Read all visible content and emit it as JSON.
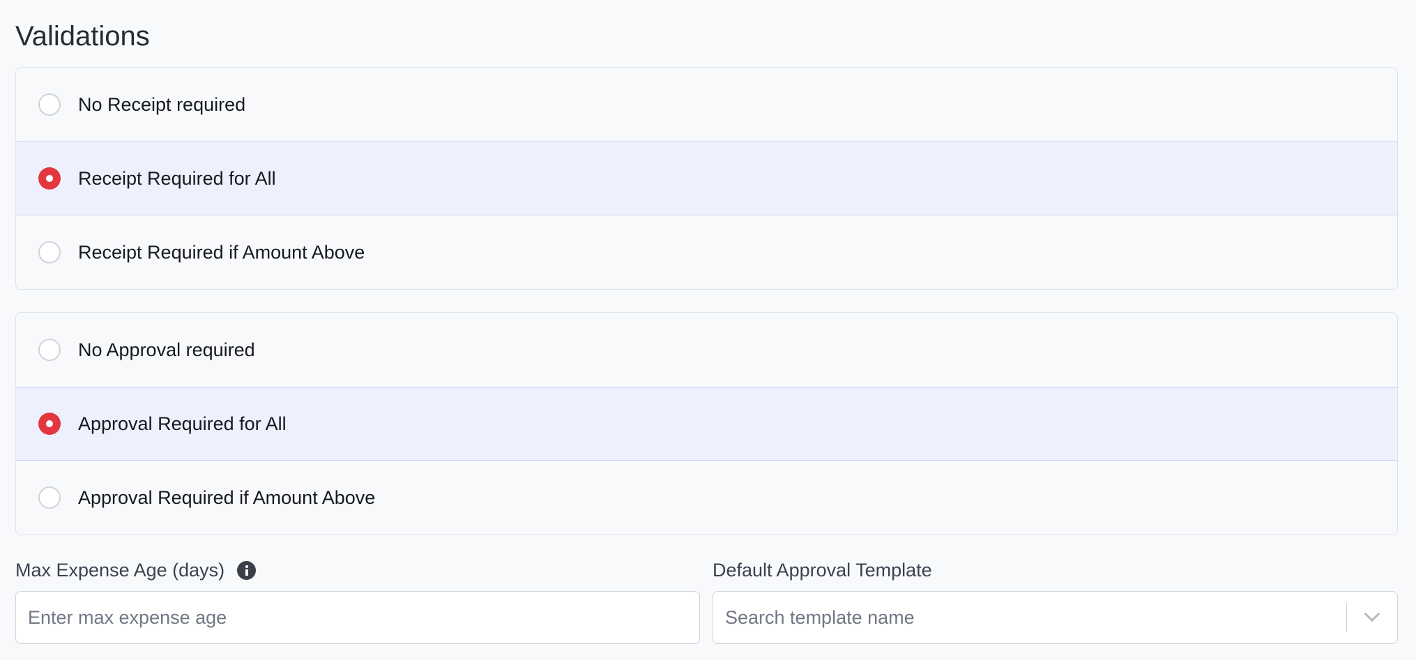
{
  "page": {
    "title": "Validations"
  },
  "receipt_options": {
    "items": [
      {
        "label": "No Receipt required",
        "selected": false
      },
      {
        "label": "Receipt Required for All",
        "selected": true
      },
      {
        "label": "Receipt Required if Amount Above",
        "selected": false
      }
    ]
  },
  "approval_options": {
    "items": [
      {
        "label": "No Approval required",
        "selected": false
      },
      {
        "label": "Approval Required for All",
        "selected": true
      },
      {
        "label": "Approval Required if Amount Above",
        "selected": false
      }
    ]
  },
  "max_expense_age": {
    "label": "Max Expense Age (days)",
    "placeholder": "Enter max expense age",
    "value": "",
    "icon": "info-icon"
  },
  "default_approval_template": {
    "label": "Default Approval Template",
    "placeholder": "Search template name",
    "value": "",
    "icon": "chevron-down-icon"
  },
  "colors": {
    "accent_selected_radio": "#e3373f",
    "selected_row_bg": "#eef1fd",
    "page_bg": "#f8f9fb"
  }
}
